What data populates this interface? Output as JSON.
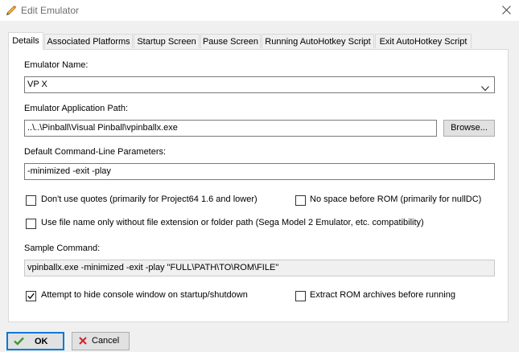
{
  "window": {
    "title": "Edit Emulator"
  },
  "tabs": [
    {
      "label": "Details"
    },
    {
      "label": "Associated Platforms"
    },
    {
      "label": "Startup Screen"
    },
    {
      "label": "Pause Screen"
    },
    {
      "label": "Running AutoHotkey Script"
    },
    {
      "label": "Exit AutoHotkey Script"
    }
  ],
  "details": {
    "name_label": "Emulator Name:",
    "name_value": "VP X",
    "path_label": "Emulator Application Path:",
    "path_value": "..\\..\\Pinball\\Visual Pinball\\vpinballx.exe",
    "browse_label": "Browse...",
    "params_label": "Default Command-Line Parameters:",
    "params_value": "-minimized -exit -play",
    "cb_no_quotes": {
      "label": "Don't use quotes (primarily for Project64 1.6 and lower)",
      "checked": false
    },
    "cb_no_space": {
      "label": "No space before ROM (primarily for nullDC)",
      "checked": false
    },
    "cb_filename_only": {
      "label": "Use file name only without file extension or folder path (Sega Model 2 Emulator, etc. compatibility)",
      "checked": false
    },
    "sample_label": "Sample Command:",
    "sample_value": "vpinballx.exe -minimized -exit -play \"FULL\\PATH\\TO\\ROM\\FILE\"",
    "cb_hide_console": {
      "label": "Attempt to hide console window on startup/shutdown",
      "checked": true
    },
    "cb_extract": {
      "label": "Extract ROM archives before running",
      "checked": false
    }
  },
  "buttons": {
    "ok": "OK",
    "cancel": "Cancel"
  },
  "colors": {
    "ok_check": "#3c9a2f",
    "cancel_x": "#d0232b",
    "focus_border": "#0078d7"
  }
}
